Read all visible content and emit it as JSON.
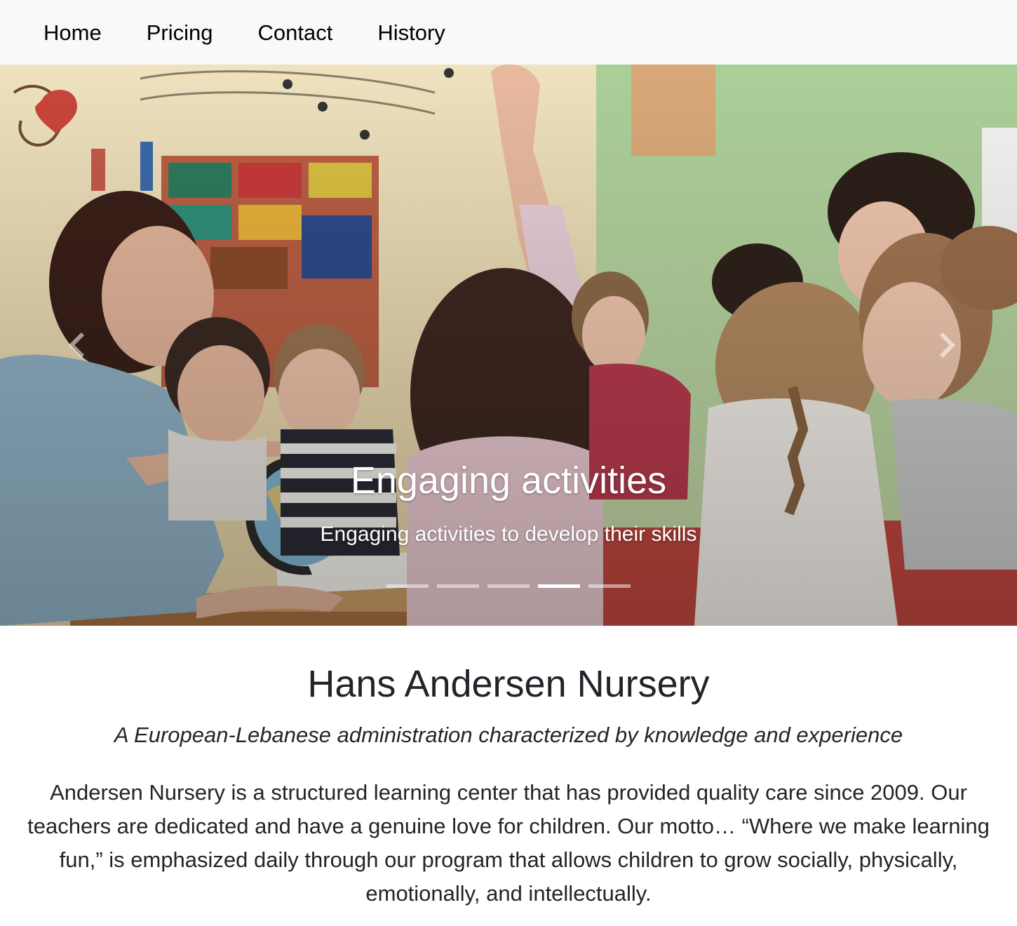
{
  "nav": {
    "items": [
      {
        "label": "Home"
      },
      {
        "label": "Pricing"
      },
      {
        "label": "Contact"
      },
      {
        "label": "History"
      }
    ]
  },
  "carousel": {
    "caption_title": "Engaging activities",
    "caption_text": "Engaging activities to develop their skills",
    "slide_count": 5,
    "active_index": 3,
    "icons": {
      "prev": "chevron-left-icon",
      "next": "chevron-right-icon"
    }
  },
  "main": {
    "title": "Hans Andersen Nursery",
    "tagline": "A European-Lebanese administration characterized by knowledge and experience",
    "description": "Andersen Nursery is a structured learning center that has provided quality care since 2009. Our teachers are dedicated and have a genuine love for children. Our motto… “Where we make learning fun,” is emphasized daily through our program that allows children to grow socially, physically, emotionally, and intellectually."
  }
}
